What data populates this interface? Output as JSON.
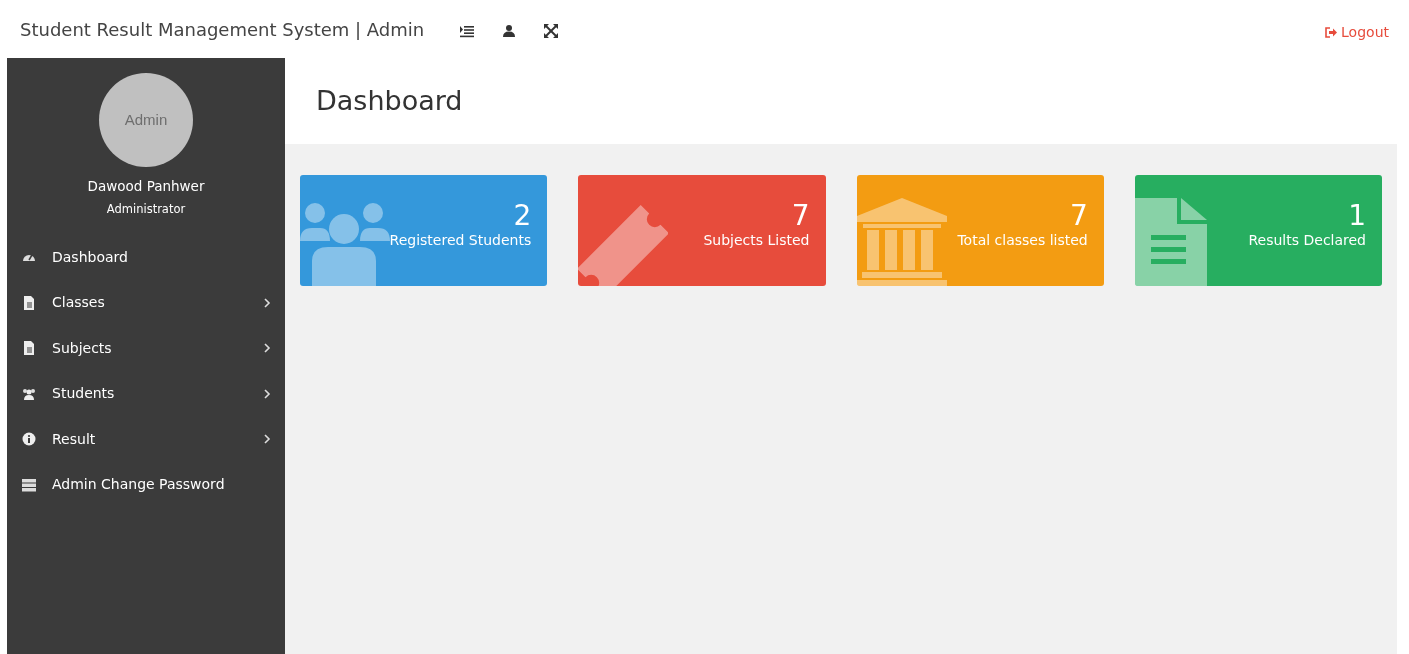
{
  "header": {
    "title": "Student Result Management System | Admin",
    "logout": "Logout"
  },
  "sidebar": {
    "avatar_text": "Admin",
    "user_name": "Dawood Panhwer",
    "user_role": "Administrator",
    "items": [
      {
        "label": "Dashboard",
        "kind": "gauge",
        "has_submenu": false
      },
      {
        "label": "Classes",
        "kind": "file",
        "has_submenu": true
      },
      {
        "label": "Subjects",
        "kind": "file",
        "has_submenu": true
      },
      {
        "label": "Students",
        "kind": "users",
        "has_submenu": true
      },
      {
        "label": "Result",
        "kind": "info",
        "has_submenu": true
      },
      {
        "label": "Admin Change Password",
        "kind": "server",
        "has_submenu": false
      }
    ]
  },
  "page_title": "Dashboard",
  "stat_cards": [
    {
      "value": "2",
      "label": "Registered Students",
      "color": "#3498db",
      "kind": "users"
    },
    {
      "value": "7",
      "label": "Subjects Listed",
      "color": "#e74c3c",
      "kind": "ticket"
    },
    {
      "value": "7",
      "label": "Total classes listed",
      "color": "#f39c12",
      "kind": "bank"
    },
    {
      "value": "1",
      "label": "Results Declared",
      "color": "#27ae60",
      "kind": "file"
    }
  ]
}
